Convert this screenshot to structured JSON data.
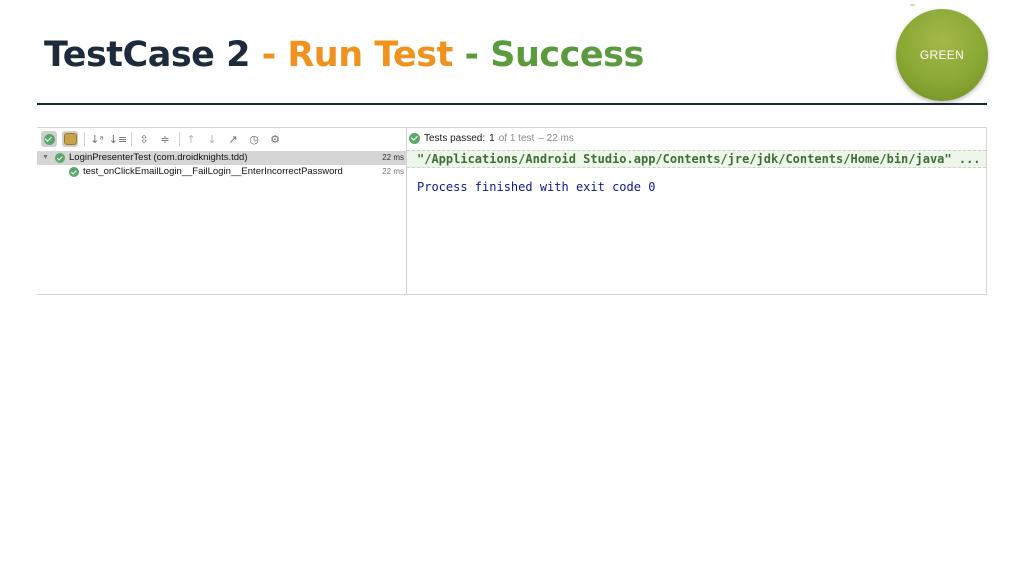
{
  "slide": {
    "title_main": "TestCase 2",
    "title_sep1": " - ",
    "title_run": "Run Test",
    "title_sep2": " - ",
    "title_success": "Success",
    "badge_label": "GREEN"
  },
  "colors": {
    "title_dark": "#1d2b3a",
    "title_orange": "#f0921e",
    "title_green": "#5b9a3e",
    "badge_green": "#8aa834",
    "pass_green": "#59a869",
    "console_blue": "#0d1a8a",
    "cmd_green": "#3f6e35"
  },
  "toolbar": {
    "icons": [
      "show-passed-check-icon",
      "show-ignored-icon",
      "sort-alphabetically-icon",
      "sort-by-duration-icon",
      "expand-all-icon",
      "collapse-all-icon",
      "previous-failed-icon",
      "next-failed-icon",
      "export-icon",
      "history-clock-icon",
      "settings-gear-icon"
    ]
  },
  "status": {
    "passed_label": "Tests passed:",
    "passed_count": "1",
    "of_total": "of 1 test",
    "duration": "– 22 ms"
  },
  "tree": {
    "rows": [
      {
        "label": "LoginPresenterTest (com.droidknights.tdd)",
        "time": "22 ms"
      },
      {
        "label": "test_onClickEmailLogin__FailLogin__EnterIncorrectPassword",
        "time": "22 ms"
      }
    ]
  },
  "console": {
    "command": "\"/Applications/Android Studio.app/Contents/jre/jdk/Contents/Home/bin/java\" ...",
    "process": "Process finished with exit code 0"
  }
}
